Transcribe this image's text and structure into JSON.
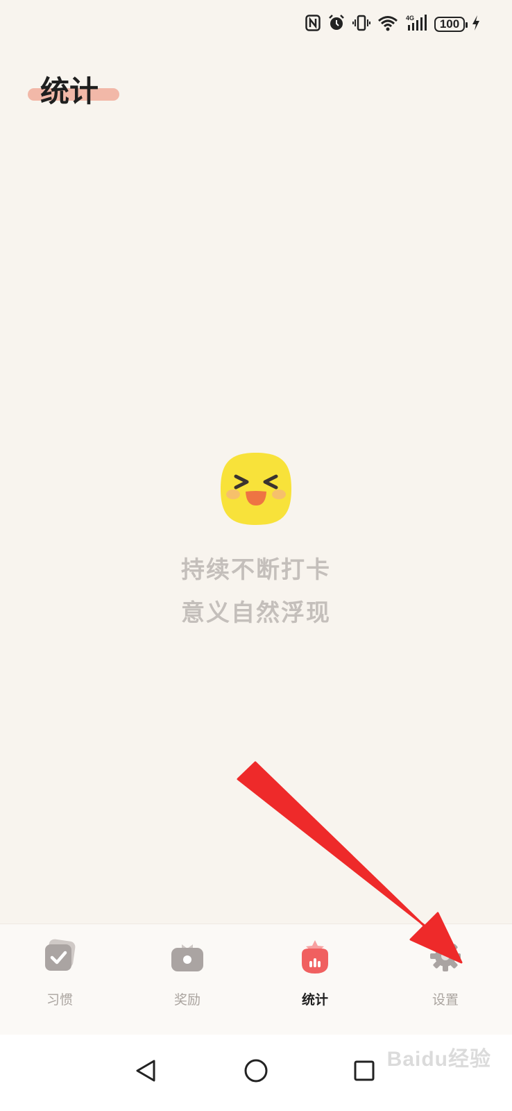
{
  "status_bar": {
    "icons": [
      "nfc-icon",
      "alarm-icon",
      "vibrate-icon",
      "wifi-icon",
      "signal-4g-icon"
    ],
    "network": "4G",
    "battery": "100"
  },
  "header": {
    "title": "统计"
  },
  "empty_state": {
    "icon": "laughing-face-icon",
    "line1": "持续不断打卡",
    "line2": "意义自然浮现"
  },
  "tabs": [
    {
      "label": "习惯",
      "icon": "habit-check-icon",
      "active": false
    },
    {
      "label": "奖励",
      "icon": "gift-box-icon",
      "active": false
    },
    {
      "label": "统计",
      "icon": "stats-icon",
      "active": true
    },
    {
      "label": "设置",
      "icon": "gear-icon",
      "active": false
    }
  ],
  "nav": [
    "back-icon",
    "home-icon",
    "recents-icon"
  ],
  "watermark": "Baidu经验",
  "colors": {
    "background": "#f8f4ee",
    "accent": "#f06060",
    "title_highlight": "#f2b8a8",
    "inactive": "#aaa49f",
    "annotation_arrow": "#ee2a2a"
  }
}
